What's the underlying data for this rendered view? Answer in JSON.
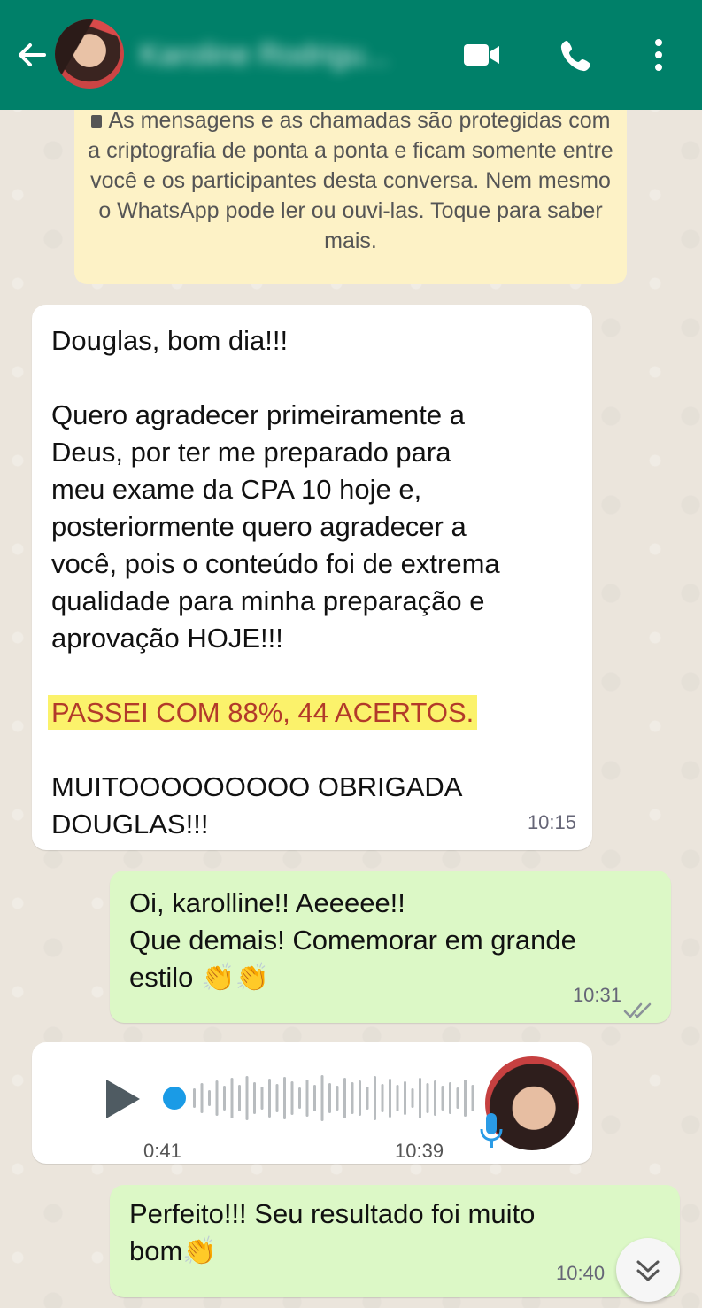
{
  "header": {
    "contact_name": "Karoline Rodrigu...",
    "color": "#008069"
  },
  "encryption_notice": {
    "text": "As mensagens e as chamadas são protegidas com a criptografia de ponta a ponta e ficam somente entre você e os participantes desta conversa. Nem mesmo o WhatsApp pode ler ou ouvi-las. Toque para saber mais."
  },
  "messages": [
    {
      "direction": "incoming",
      "greeting": "Douglas, bom dia!!!",
      "body": "Quero agradecer primeiramente a\nDeus, por ter me preparado para\nmeu exame da CPA 10 hoje e,\nposteriormente quero agradecer a\nvocê, pois o conteúdo foi de extrema\nqualidade para minha preparação e\naprovação HOJE!!!",
      "highlight": "PASSEI COM 88%, 44 ACERTOS.",
      "closing": "MUITOOOOOOOOO OBRIGADA\nDOUGLAS!!!",
      "time": "10:15"
    },
    {
      "direction": "outgoing",
      "text": "Oi, karolline!! Aeeeee!!\nQue demais! Comemorar em grande\nestilo 👏👏",
      "time": "10:31",
      "status": "read"
    },
    {
      "direction": "incoming",
      "type": "voice",
      "duration": "0:41",
      "time": "10:39",
      "waveform_dot_color": "#1a9be6"
    },
    {
      "direction": "outgoing",
      "text": "Perfeito!!! Seu resultado foi muito\nbom👏",
      "time": "10:40"
    }
  ],
  "colors": {
    "incoming_bubble": "#ffffff",
    "outgoing_bubble": "#dcf8c6",
    "notice_bg": "#fdf2c6",
    "highlight_bg": "#fbf26b",
    "highlight_text": "#b23a2a"
  },
  "icons": {
    "back": "arrow-left-icon",
    "video": "video-call-icon",
    "call": "phone-icon",
    "menu": "more-vert-icon",
    "play": "play-icon",
    "mic": "mic-icon",
    "scroll": "chevron-double-down-icon"
  }
}
